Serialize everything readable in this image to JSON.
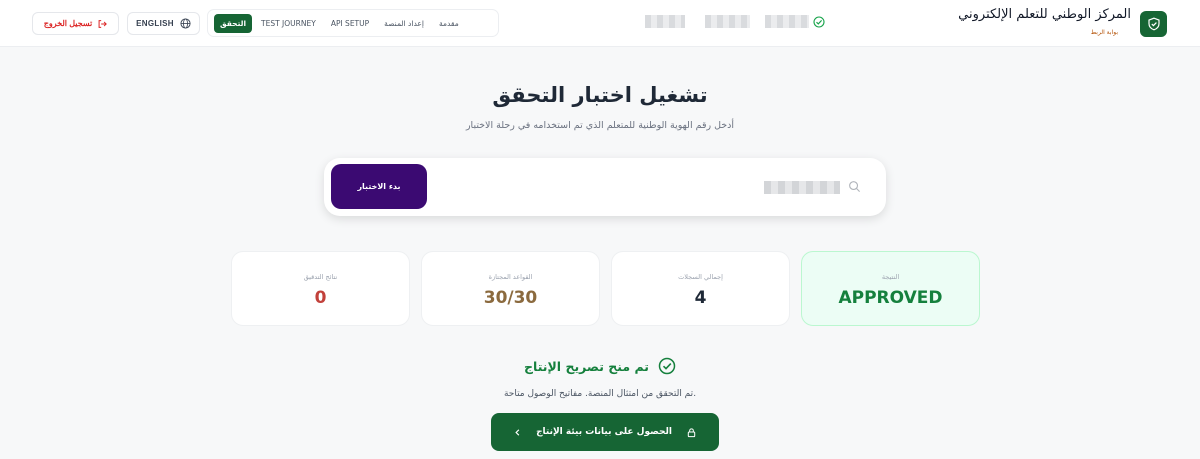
{
  "header": {
    "brand_title": "المركز الوطني للتعلم الإلكتروني",
    "brand_subtitle": "بوابة الربط",
    "logout_label": "تسجيل الخروج",
    "language_label": "ENGLISH",
    "nav_tabs": [
      {
        "label": "التحقق",
        "active": true
      },
      {
        "label": "TEST JOURNEY",
        "active": false
      },
      {
        "label": "API SETUP",
        "active": false
      },
      {
        "label": "إعداد المنصة",
        "active": false
      },
      {
        "label": "مقدمة",
        "active": false
      }
    ]
  },
  "main": {
    "title": "تشغيل اختبار التحقق",
    "subtitle": "أدخل رقم الهوية الوطنية للمتعلم الذي تم استخدامه في رحلة الاختبار",
    "start_button_label": "بدء الاختبار"
  },
  "stats": [
    {
      "label": "نتائج التدقيق",
      "value": "0",
      "color": "#c2413b"
    },
    {
      "label": "القواعد المجتازة",
      "value": "30/30",
      "color": "#8b6a3e"
    },
    {
      "label": "إجمالي السجلات",
      "value": "4",
      "color": "#1f2937"
    },
    {
      "label": "النتيجة",
      "value": "APPROVED",
      "color": "#15803d"
    }
  ],
  "approval": {
    "title": "تم منح تصريح الإنتاج",
    "description": "تم التحقق من امتثال المنصة. مفاتيح الوصول متاحة.",
    "button_label": "الحصول على بيانات بيئة الإنتاج"
  },
  "colors": {
    "primary_green": "#166534",
    "start_button": "#3b0a72",
    "logout_red": "#dc2626"
  },
  "icons": [
    "logout-icon",
    "globe-icon",
    "verified-icon",
    "shield-check-icon",
    "search-icon",
    "check-circle-icon",
    "lock-icon",
    "chevron-left-icon"
  ]
}
